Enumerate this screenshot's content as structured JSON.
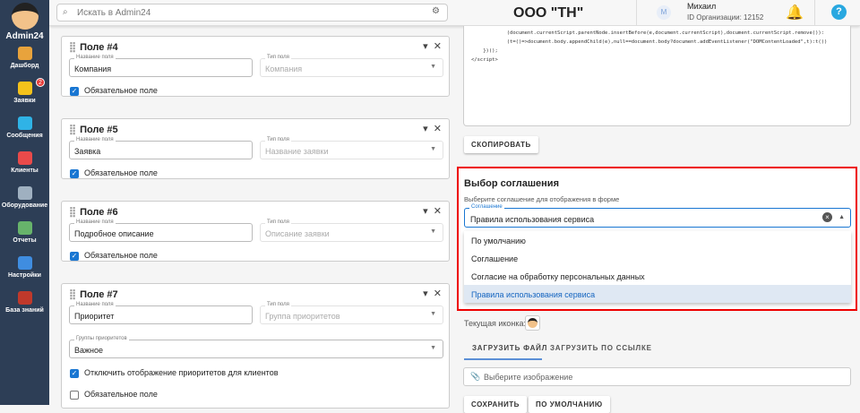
{
  "sidebar": {
    "brand": "Admin24",
    "items": [
      {
        "label": "Дашборд",
        "color": "#e8a33c"
      },
      {
        "label": "Заявки",
        "color": "#f4c21b",
        "badge": "2"
      },
      {
        "label": "Сообщения",
        "color": "#2fb3e6"
      },
      {
        "label": "Клиенты",
        "color": "#e94a4a"
      },
      {
        "label": "Оборудование",
        "color": "#9fb0c0"
      },
      {
        "label": "Отчеты",
        "color": "#67b36b"
      },
      {
        "label": "Настройки",
        "color": "#3f8de0"
      },
      {
        "label": "База знаний",
        "color": "#c0392b"
      }
    ]
  },
  "header": {
    "search_placeholder": "Искать в Admin24",
    "org": "ООО \"ТН\"",
    "user_initial": "M",
    "user_name": "Михаил",
    "org_id": "ID Организации: 12152"
  },
  "fields": [
    {
      "title": "Поле #4",
      "name_label": "Название поля",
      "name": "Компания",
      "type_label": "Тип поля",
      "type": "Компания",
      "required": "Обязательное поле"
    },
    {
      "title": "Поле #5",
      "name_label": "Название поля",
      "name": "Заявка",
      "type_label": "Тип поля",
      "type": "Название заявки",
      "required": "Обязательное поле"
    },
    {
      "title": "Поле #6",
      "name_label": "Название поля",
      "name": "Подробное описание",
      "type_label": "Тип поля",
      "type": "Описание заявки",
      "required": "Обязательное поле"
    },
    {
      "title": "Поле #7",
      "name_label": "Название поля",
      "name": "Приоритет",
      "type_label": "Тип поля",
      "type": "Группа приоритетов",
      "group_label": "Группы приоритетов",
      "group": "Важное",
      "hide_priorities": "Отключить отображение приоритетов для клиентов",
      "required": "Обязательное поле"
    }
  ],
  "code": {
    "text": "            (document.currentScript.parentNode.insertBefore(e,document.currentScript),document.currentScript.remove()):\n            (t=()=>document.body.appendChild(e),null==document.body?document.addEventListener(\"DOMContentLoaded\",t):t())\n    })();\n</script>",
    "copy": "СКОПИРОВАТЬ"
  },
  "agreement": {
    "title": "Выбор соглашения",
    "subtitle": "Выберите соглашение для отображения в форме",
    "label": "Соглашение",
    "value": "Правила использования сервиса",
    "options": [
      "По умолчанию",
      "Соглашение",
      "Согласие на обработку персональных данных",
      "Правила использования сервиса"
    ]
  },
  "icon": {
    "current_label": "Текущая иконка:",
    "tabs": [
      "ЗАГРУЗИТЬ ФАЙЛ",
      "ЗАГРУЗИТЬ ПО ССЫЛКЕ"
    ],
    "file_placeholder": "Выберите изображение",
    "save": "СОХРАНИТЬ",
    "default": "ПО УМОЛЧАНИЮ"
  }
}
